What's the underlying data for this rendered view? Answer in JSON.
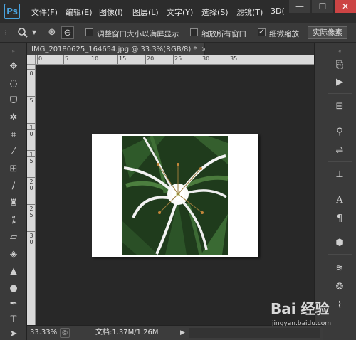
{
  "app": {
    "logo": "Ps"
  },
  "menu": {
    "items": [
      "文件(F)",
      "编辑(E)",
      "图像(I)",
      "图层(L)",
      "文字(Y)",
      "选择(S)",
      "滤镜(T)",
      "3D("
    ]
  },
  "window_controls": {
    "minimize": "—",
    "maximize": "☐",
    "close": "✕"
  },
  "options_bar": {
    "zoom_in": "⊕",
    "zoom_out": "⊖",
    "resize_window_label": "调整窗口大小以满屏显示",
    "resize_window_checked": false,
    "zoom_all_label": "缩放所有窗口",
    "zoom_all_checked": false,
    "scrubby_label": "细微缩放",
    "scrubby_checked": true,
    "actual_pixels_label": "实际像素"
  },
  "document": {
    "tab_title": "IMG_20180625_164654.jpg @ 33.3%(RGB/8) *",
    "close_glyph": "×"
  },
  "ruler": {
    "h_ticks": [
      "0",
      "5",
      "10",
      "15",
      "20",
      "25",
      "30",
      "35"
    ],
    "v_ticks": [
      "0",
      "5",
      "1",
      "0",
      "1",
      "5",
      "2",
      "0",
      "2",
      "5",
      "3",
      "0"
    ]
  },
  "status_bar": {
    "zoom": "33.33%",
    "doc_info": "文档:1.37M/1.26M",
    "arrow": "▶"
  },
  "watermark": {
    "logo": "Bai 经验",
    "url": "jingyan.baidu.com"
  },
  "colors": {
    "accent": "#4aa3df",
    "canvas_bg": "#282828",
    "panel_bg": "#3a3a3a"
  }
}
